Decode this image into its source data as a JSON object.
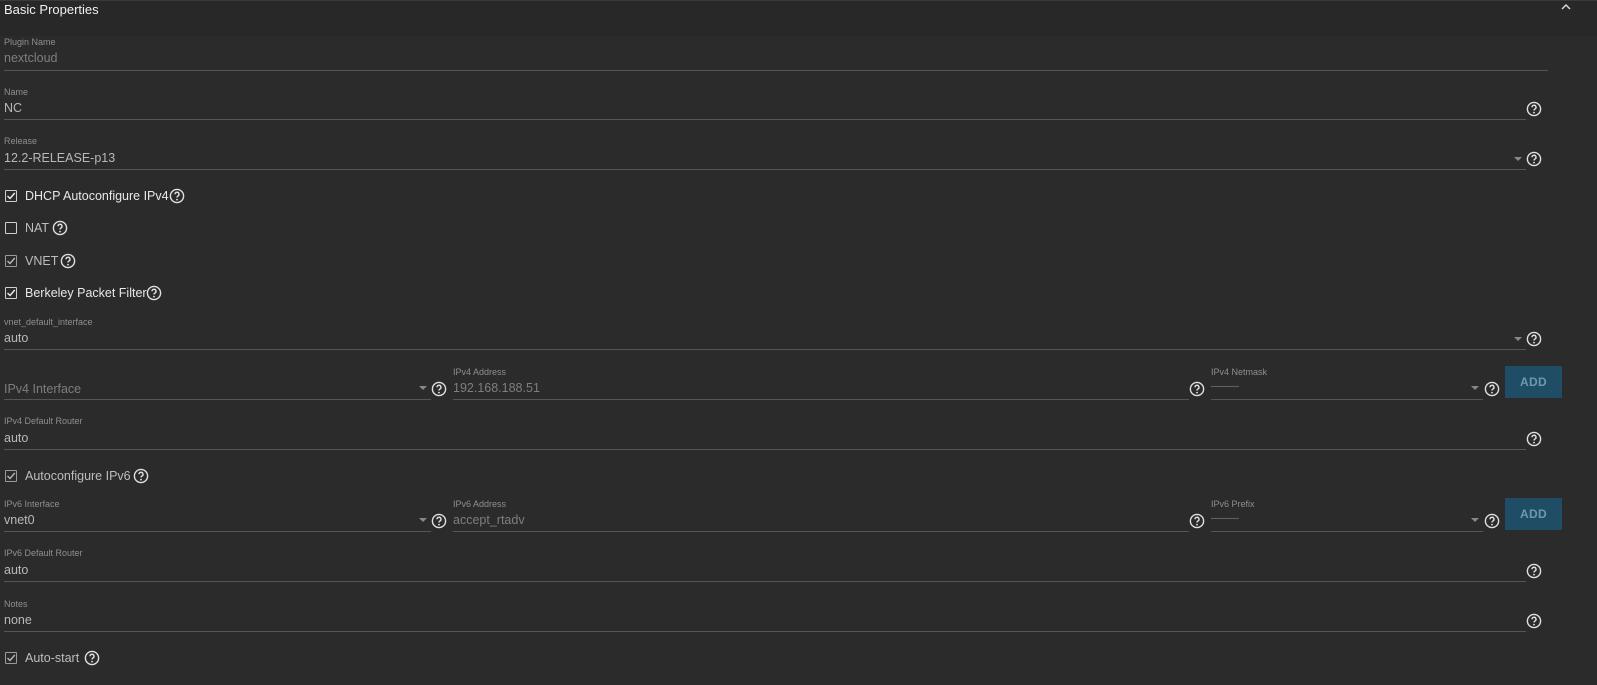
{
  "section": {
    "title": "Basic Properties"
  },
  "plugin_name": {
    "label": "Plugin Name",
    "value": "nextcloud"
  },
  "name_field": {
    "label": "Name",
    "value": "NC"
  },
  "release": {
    "label": "Release",
    "value": "12.2-RELEASE-p13"
  },
  "dhcp": {
    "label": "DHCP Autoconfigure IPv4",
    "checked": true
  },
  "nat": {
    "label": "NAT",
    "checked": false
  },
  "vnet": {
    "label": "VNET",
    "checked": true
  },
  "bpf": {
    "label": "Berkeley Packet Filter",
    "checked": true
  },
  "vnet_default_interface": {
    "label": "vnet_default_interface",
    "value": "auto"
  },
  "ipv4": {
    "interface_placeholder": "IPv4 Interface",
    "address_label": "IPv4 Address",
    "address_value": "192.168.188.51",
    "netmask_label": "IPv4 Netmask",
    "netmask_value": "———",
    "add_label": "ADD"
  },
  "ipv4_default_router": {
    "label": "IPv4 Default Router",
    "value": "auto"
  },
  "autoconf_ipv6": {
    "label": "Autoconfigure IPv6",
    "checked": true
  },
  "ipv6": {
    "interface_label": "IPv6 Interface",
    "interface_value": "vnet0",
    "address_label": "IPv6 Address",
    "address_value": "accept_rtadv",
    "prefix_label": "IPv6 Prefix",
    "prefix_value": "———",
    "add_label": "ADD"
  },
  "ipv6_default_router": {
    "label": "IPv6 Default Router",
    "value": "auto"
  },
  "notes": {
    "label": "Notes",
    "value": "none"
  },
  "autostart": {
    "label": "Auto-start",
    "checked": true
  },
  "icons": {
    "help": "help-circle-icon",
    "collapse": "chevron-up-icon",
    "dropdown": "caret-down-icon",
    "check": "check-icon"
  },
  "colors": {
    "background": "#2b2b2b",
    "header": "#282828",
    "button": "#1f4d66",
    "button_text": "#6f98ad"
  }
}
